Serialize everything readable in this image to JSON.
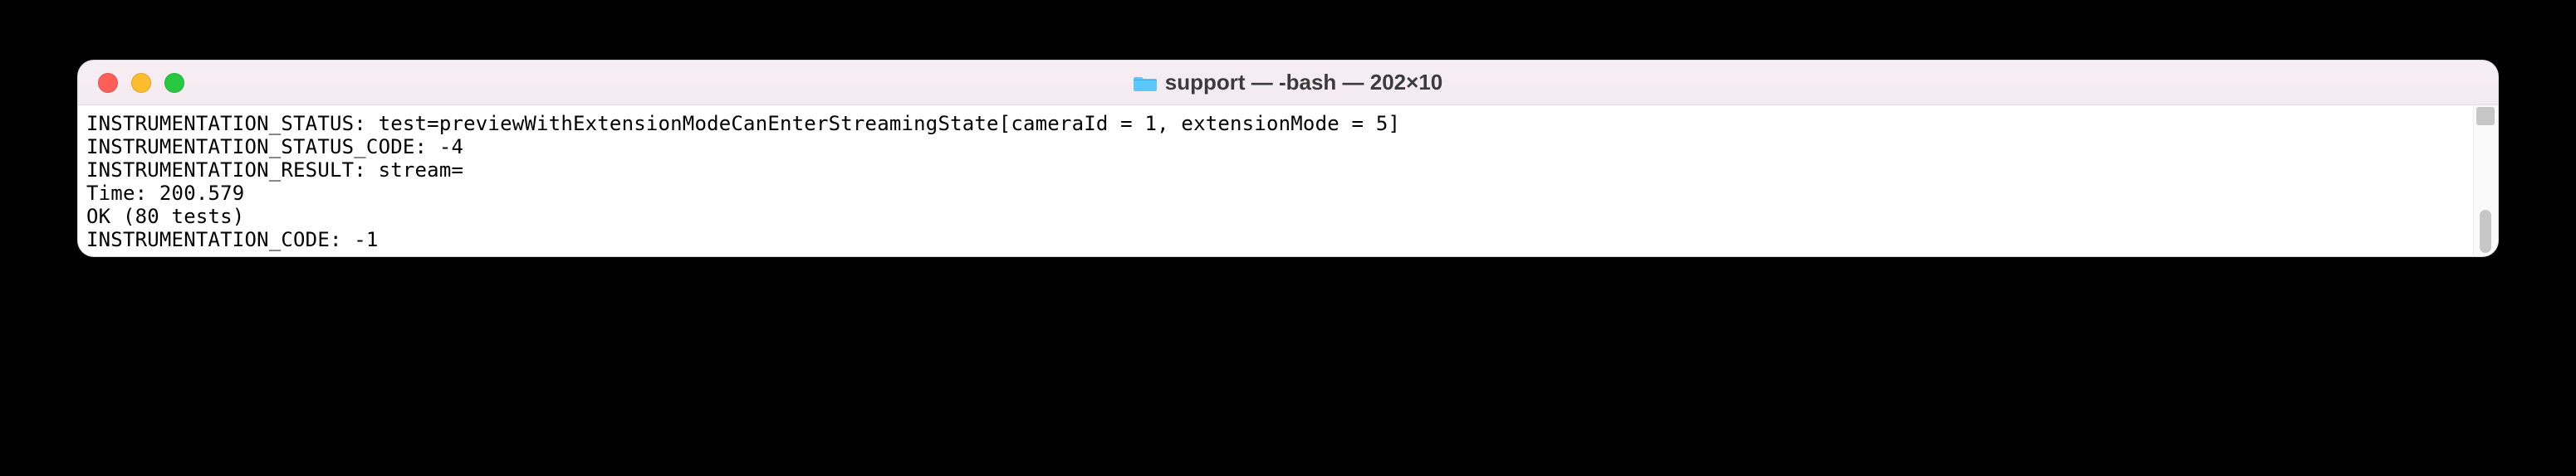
{
  "window": {
    "title": "support — -bash — 202×10"
  },
  "terminal": {
    "lines": [
      "INSTRUMENTATION_STATUS: test=previewWithExtensionModeCanEnterStreamingState[cameraId = 1, extensionMode = 5]",
      "INSTRUMENTATION_STATUS_CODE: -4",
      "INSTRUMENTATION_RESULT: stream=",
      "",
      "Time: 200.579",
      "",
      "OK (80 tests)",
      "",
      "",
      "INSTRUMENTATION_CODE: -1"
    ]
  }
}
